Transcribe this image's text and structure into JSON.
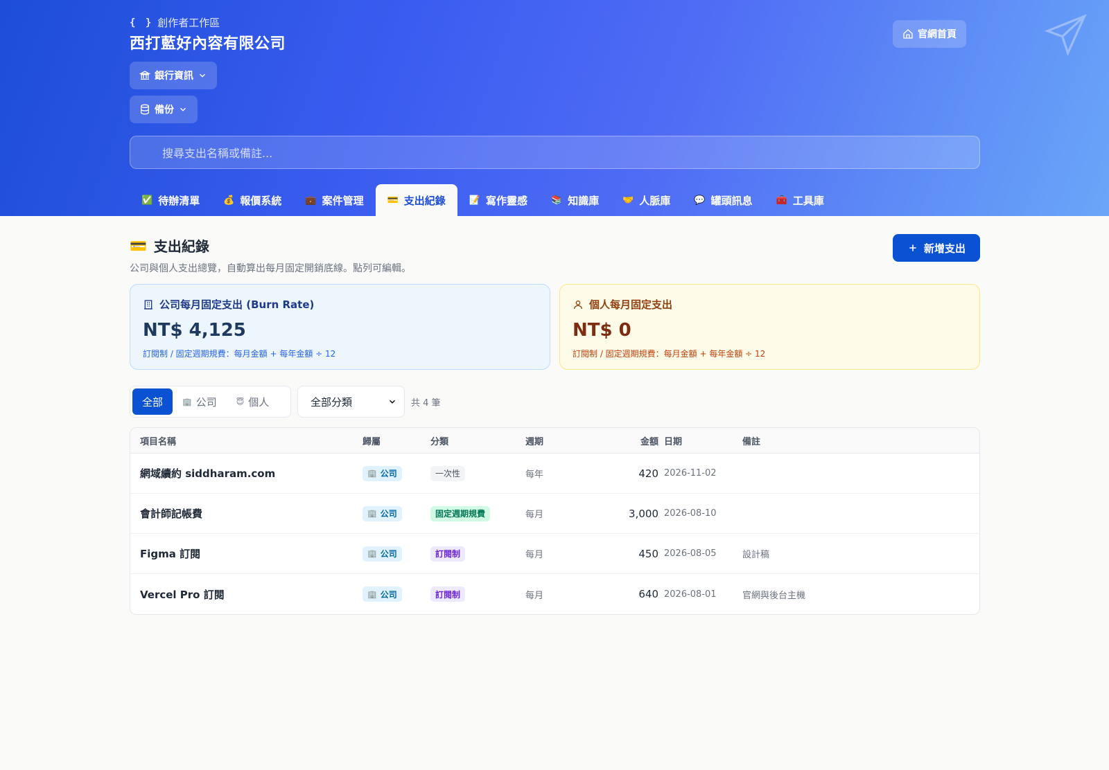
{
  "header": {
    "workspace_label": "創作者工作區",
    "braces": "{ }",
    "company_name": "西打藍好內容有限公司",
    "bank_label": "銀行資訊",
    "backup_label": "備份",
    "home_label": "官網首頁"
  },
  "search": {
    "placeholder": "搜尋支出名稱或備註..."
  },
  "tabs": [
    {
      "emoji": "✅",
      "label": "待辦清單"
    },
    {
      "emoji": "💰",
      "label": "報價系統"
    },
    {
      "emoji": "💼",
      "label": "案件管理"
    },
    {
      "emoji": "💳",
      "label": "支出紀錄"
    },
    {
      "emoji": "📝",
      "label": "寫作靈感"
    },
    {
      "emoji": "📚",
      "label": "知識庫"
    },
    {
      "emoji": "🤝",
      "label": "人脈庫"
    },
    {
      "emoji": "💬",
      "label": "罐頭訊息"
    },
    {
      "emoji": "🧰",
      "label": "工具庫"
    }
  ],
  "page": {
    "emoji": "💳",
    "title": "支出紀錄",
    "description": "公司與個人支出總覽，自動算出每月固定開銷底線。點列可編輯。",
    "add_label": "新增支出"
  },
  "cards": {
    "company": {
      "label": "公司每月固定支出 (Burn Rate)",
      "value": "NT$ 4,125",
      "note": "訂閱制 / 固定週期規費：每月金額 + 每年金額 ÷ 12"
    },
    "personal": {
      "label": "個人每月固定支出",
      "value": "NT$ 0",
      "note": "訂閱制 / 固定週期規費：每月金額 + 每年金額 ÷ 12"
    }
  },
  "filters": {
    "all": "全部",
    "company": "公司",
    "company_emoji": "🏢",
    "personal": "個人",
    "personal_emoji": "😇",
    "category_selected": "全部分類",
    "count": "共 4 筆"
  },
  "table": {
    "headers": {
      "name": "項目名稱",
      "owner": "歸屬",
      "category": "分類",
      "cycle": "週期",
      "amount": "金額",
      "date": "日期",
      "note": "備註"
    },
    "rows": [
      {
        "name": "網域續約 siddharam.com",
        "owner": "公司",
        "category": "一次性",
        "cycle": "每年",
        "amount": "420",
        "date": "2026-11-02",
        "note": ""
      },
      {
        "name": "會計師記帳費",
        "owner": "公司",
        "category": "固定週期規費",
        "cycle": "每月",
        "amount": "3,000",
        "date": "2026-08-10",
        "note": ""
      },
      {
        "name": "Figma 訂閱",
        "owner": "公司",
        "category": "訂閱制",
        "cycle": "每月",
        "amount": "450",
        "date": "2026-08-05",
        "note": "設計稿"
      },
      {
        "name": "Vercel Pro 訂閱",
        "owner": "公司",
        "category": "訂閱制",
        "cycle": "每月",
        "amount": "640",
        "date": "2026-08-01",
        "note": "官網與後台主機"
      }
    ]
  },
  "colors": {
    "brand": "#0b52d3",
    "hero_start": "#1d4ed8",
    "hero_end": "#6aa6f8"
  },
  "icons": {
    "bank": "bank-icon",
    "backup": "database-icon",
    "home": "home-icon",
    "plane": "paper-plane-icon",
    "search": "search-icon",
    "add": "plus-icon",
    "company_card": "building-icon",
    "personal_card": "user-icon"
  }
}
